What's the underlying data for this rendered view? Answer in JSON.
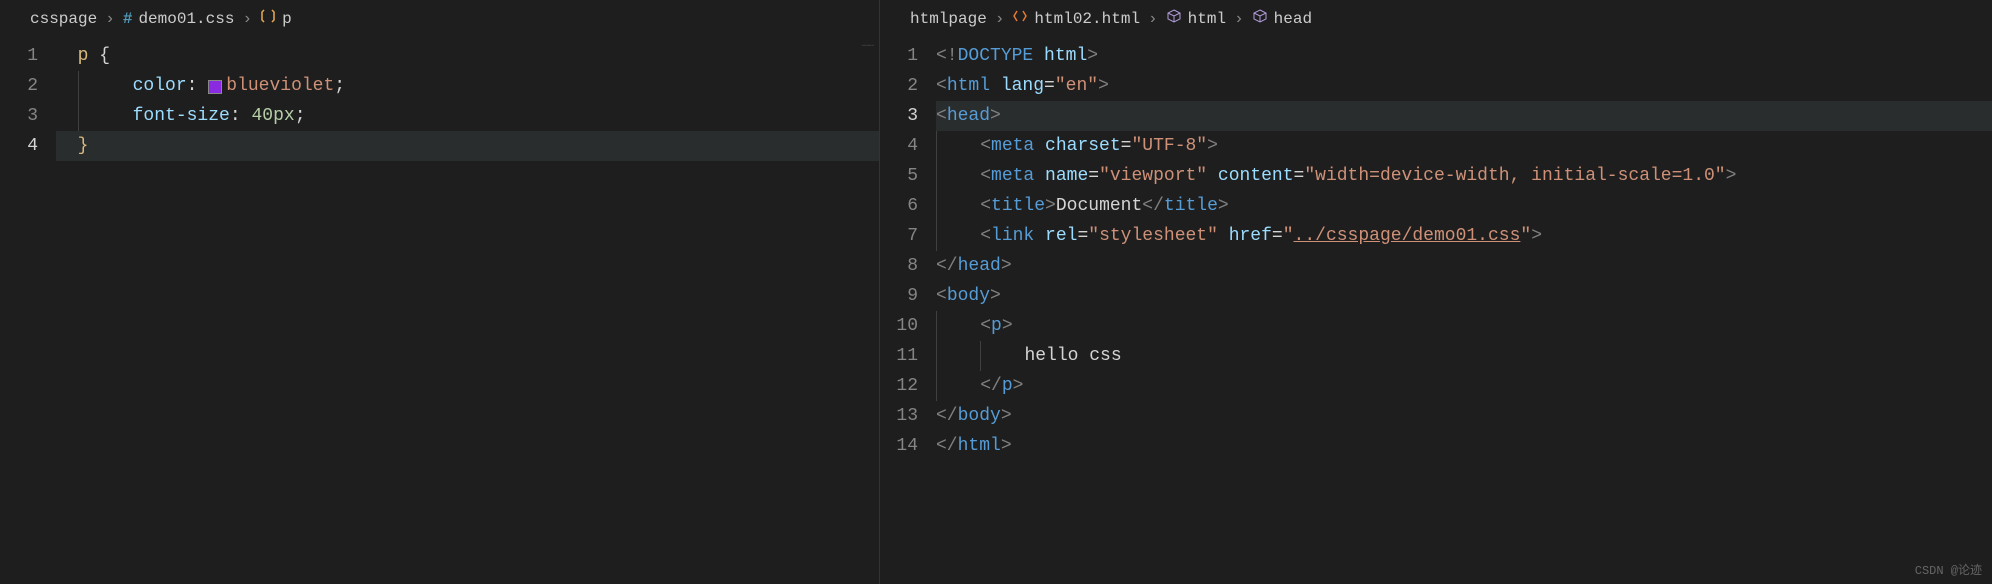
{
  "left": {
    "breadcrumb": {
      "folder": "csspage",
      "file": "demo01.css",
      "symbol": "p"
    },
    "gutter": [
      "1",
      "2",
      "3",
      "4"
    ],
    "activeLine": 4,
    "code": {
      "l1_sel": "p",
      "l1_brace": " {",
      "l2_prop": "color",
      "l2_colon": ":",
      "l2_val": "blueviolet",
      "l2_semi": ";",
      "l3_prop": "font-size",
      "l3_colon": ":",
      "l3_val": "40px",
      "l3_semi": ";",
      "l4_brace": "}"
    }
  },
  "right": {
    "breadcrumb": {
      "folder": "htmlpage",
      "file": "html02.html",
      "sym1": "html",
      "sym2": "head"
    },
    "gutter": [
      "1",
      "2",
      "3",
      "4",
      "5",
      "6",
      "7",
      "8",
      "9",
      "10",
      "11",
      "12",
      "13",
      "14"
    ],
    "activeLine": 3,
    "code": {
      "l1_a": "<!",
      "l1_b": "DOCTYPE",
      "l1_c": " html",
      "l1_d": ">",
      "l2_a": "<",
      "l2_tag": "html",
      "l2_attr": " lang",
      "l2_eq": "=",
      "l2_val": "\"en\"",
      "l2_c": ">",
      "l3_a": "<",
      "l3_tag": "head",
      "l3_c": ">",
      "l4_a": "<",
      "l4_tag": "meta",
      "l4_attr": " charset",
      "l4_eq": "=",
      "l4_val": "\"UTF-8\"",
      "l4_c": ">",
      "l5_a": "<",
      "l5_tag": "meta",
      "l5_attr1": " name",
      "l5_eq1": "=",
      "l5_val1": "\"viewport\"",
      "l5_attr2": " content",
      "l5_eq2": "=",
      "l5_val2": "\"width=device-width, initial-scale=1.0\"",
      "l5_c": ">",
      "l6_a": "<",
      "l6_tag": "title",
      "l6_b": ">",
      "l6_txt": "Document",
      "l6_c": "</",
      "l6_tag2": "title",
      "l6_d": ">",
      "l7_a": "<",
      "l7_tag": "link",
      "l7_attr1": " rel",
      "l7_eq1": "=",
      "l7_val1": "\"stylesheet\"",
      "l7_attr2": " href",
      "l7_eq2": "=",
      "l7_val2a": "\"",
      "l7_val2b": "../csspage/demo01.css",
      "l7_val2c": "\"",
      "l7_c": ">",
      "l8_a": "</",
      "l8_tag": "head",
      "l8_c": ">",
      "l9_a": "<",
      "l9_tag": "body",
      "l9_c": ">",
      "l10_a": "<",
      "l10_tag": "p",
      "l10_c": ">",
      "l11_txt": "hello css",
      "l12_a": "</",
      "l12_tag": "p",
      "l12_c": ">",
      "l13_a": "</",
      "l13_tag": "body",
      "l13_c": ">",
      "l14_a": "</",
      "l14_tag": "html",
      "l14_c": ">"
    }
  },
  "watermark": "CSDN @论迹",
  "colors": {
    "blueviolet": "#8a2be2"
  }
}
